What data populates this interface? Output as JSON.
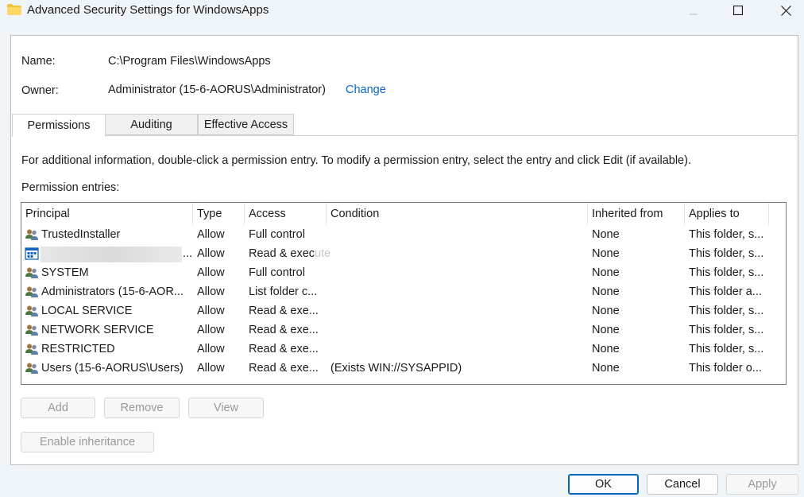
{
  "window": {
    "title": "Advanced Security Settings for WindowsApps",
    "icon": "folder-icon"
  },
  "info": {
    "name_label": "Name:",
    "name_value": "C:\\Program Files\\WindowsApps",
    "owner_label": "Owner:",
    "owner_value": "Administrator (15-6-AORUS\\Administrator)",
    "change_link": "Change"
  },
  "tabs": [
    {
      "label": "Permissions"
    },
    {
      "label": "Auditing"
    },
    {
      "label": "Effective Access"
    }
  ],
  "permissions": {
    "instructions": "For additional information, double-click a permission entry. To modify a permission entry, select the entry and click Edit (if available).",
    "entries_label": "Permission entries:",
    "columns": [
      "Principal",
      "Type",
      "Access",
      "Condition",
      "Inherited from",
      "Applies to"
    ],
    "rows": [
      {
        "principal": "TrustedInstaller",
        "type": "Allow",
        "access": "Full control",
        "condition": "",
        "inherited": "None",
        "applies": "This folder, s...",
        "icon": "group-icon"
      },
      {
        "principal": "...",
        "type": "Allow",
        "access": "Read & exec",
        "access_ghost": "ute",
        "condition": "",
        "inherited": "None",
        "applies": "This folder, s...",
        "icon": "app-package-icon"
      },
      {
        "principal": "SYSTEM",
        "type": "Allow",
        "access": "Full control",
        "condition": "",
        "inherited": "None",
        "applies": "This folder, s...",
        "icon": "group-icon"
      },
      {
        "principal": "Administrators (15-6-AOR...",
        "type": "Allow",
        "access": "List folder c...",
        "condition": "",
        "inherited": "None",
        "applies": "This folder a...",
        "icon": "group-icon"
      },
      {
        "principal": "LOCAL SERVICE",
        "type": "Allow",
        "access": "Read & exe...",
        "condition": "",
        "inherited": "None",
        "applies": "This folder, s...",
        "icon": "group-icon"
      },
      {
        "principal": "NETWORK SERVICE",
        "type": "Allow",
        "access": "Read & exe...",
        "condition": "",
        "inherited": "None",
        "applies": "This folder, s...",
        "icon": "group-icon"
      },
      {
        "principal": "RESTRICTED",
        "type": "Allow",
        "access": "Read & exe...",
        "condition": "",
        "inherited": "None",
        "applies": "This folder, s...",
        "icon": "group-icon"
      },
      {
        "principal": "Users (15-6-AORUS\\Users)",
        "type": "Allow",
        "access": "Read & exe...",
        "condition": "(Exists WIN://SYSAPPID)",
        "inherited": "None",
        "applies": "This folder o...",
        "icon": "group-icon"
      }
    ]
  },
  "actions": {
    "add": "Add",
    "remove": "Remove",
    "view": "View",
    "enable_inheritance": "Enable inheritance"
  },
  "footer": {
    "ok": "OK",
    "cancel": "Cancel",
    "apply": "Apply"
  },
  "colors": {
    "link": "#0a66c2",
    "focus": "#0067c0",
    "window_bg": "#eff4f9"
  }
}
